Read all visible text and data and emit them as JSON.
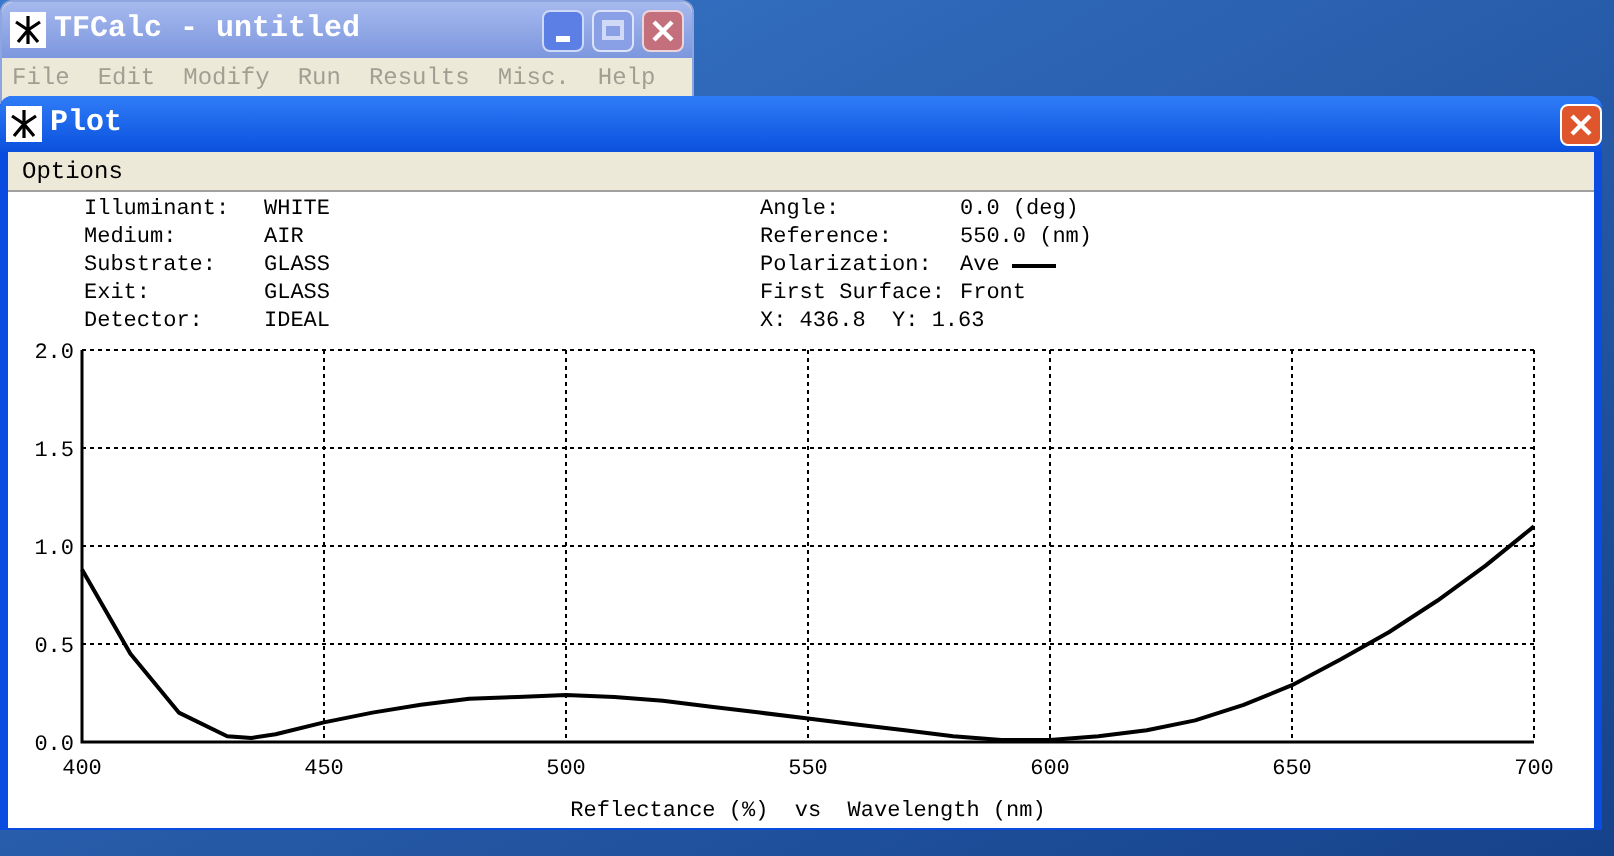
{
  "main_window": {
    "title": "TFCalc - untitled",
    "menu": [
      {
        "label": "File",
        "disabled": true
      },
      {
        "label": "Edit",
        "disabled": true
      },
      {
        "label": "Modify",
        "disabled": true
      },
      {
        "label": "Run",
        "disabled": true
      },
      {
        "label": "Results",
        "disabled": true
      },
      {
        "label": "Misc.",
        "disabled": true
      },
      {
        "label": "Help",
        "disabled": true
      }
    ]
  },
  "plot_window": {
    "title": "Plot",
    "menu": [
      {
        "label": "Options",
        "disabled": false
      }
    ],
    "info_left": [
      {
        "label": "Illuminant:",
        "value": "WHITE"
      },
      {
        "label": "Medium:",
        "value": "AIR"
      },
      {
        "label": "Substrate:",
        "value": "GLASS"
      },
      {
        "label": "Exit:",
        "value": "GLASS"
      },
      {
        "label": "Detector:",
        "value": "IDEAL"
      }
    ],
    "info_right": [
      {
        "label": "Angle:",
        "value": "0.0 (deg)",
        "kind": "text"
      },
      {
        "label": "Reference:",
        "value": "550.0 (nm)",
        "kind": "text"
      },
      {
        "label": "Polarization:",
        "kind": "legend"
      },
      {
        "label": "First Surface:",
        "value": "Front",
        "kind": "text"
      },
      {
        "label": "X: 436.8  Y: 1.63",
        "kind": "cursor"
      }
    ],
    "chart_data": {
      "type": "line",
      "grid": true,
      "xlabel": "Reflectance (%)  vs  Wavelength (nm)",
      "xlim": [
        400,
        700
      ],
      "ylim": [
        0,
        2
      ],
      "xticks": [
        400,
        450,
        500,
        550,
        600,
        650,
        700
      ],
      "yticks": [
        {
          "value": 0,
          "label": "0.0"
        },
        {
          "value": 0.5,
          "label": "0.5"
        },
        {
          "value": 1,
          "label": "1.0"
        },
        {
          "value": 1.5,
          "label": "1.5"
        },
        {
          "value": 2,
          "label": "2.0"
        }
      ],
      "x": [
        400,
        410,
        420,
        430,
        435,
        440,
        450,
        460,
        470,
        480,
        490,
        500,
        510,
        520,
        530,
        540,
        550,
        560,
        570,
        580,
        590,
        600,
        610,
        620,
        630,
        640,
        650,
        660,
        670,
        680,
        690,
        700
      ],
      "series": [
        {
          "name": "Ave",
          "color": "#000000",
          "values": [
            0.88,
            0.45,
            0.15,
            0.03,
            0.02,
            0.04,
            0.1,
            0.15,
            0.19,
            0.22,
            0.23,
            0.24,
            0.23,
            0.21,
            0.18,
            0.15,
            0.12,
            0.09,
            0.06,
            0.03,
            0.01,
            0.01,
            0.03,
            0.06,
            0.11,
            0.19,
            0.29,
            0.42,
            0.56,
            0.72,
            0.9,
            1.1
          ]
        }
      ]
    }
  }
}
